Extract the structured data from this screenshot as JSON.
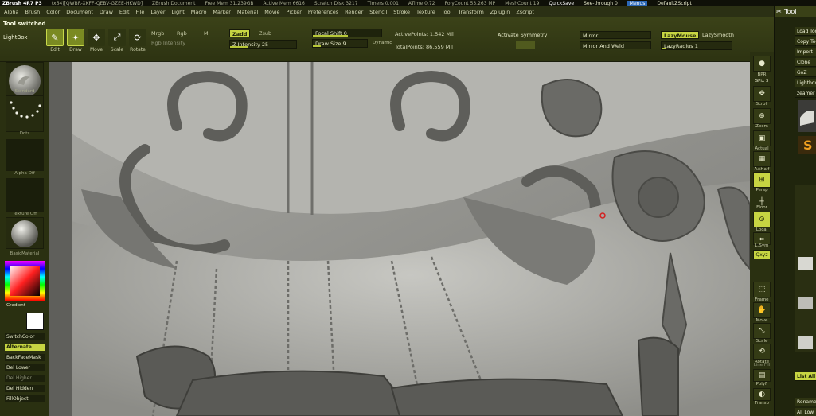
{
  "titlebar": {
    "app": "ZBrush 4R7 P3",
    "build": "(x64)[QWBR-XKFF-QEBV-GZEE-HKWD]",
    "document": "ZBrush Document",
    "free_mem": "Free Mem 31.239GB",
    "active_mem": "Active Mem 6616",
    "scratch": "Scratch Disk 3217",
    "timers": "Timers 0.001",
    "atime": "ATime 0.72",
    "polycount": "PolyCount 53.263 MP",
    "meshcount": "MeshCount 19",
    "quicksave": "QuickSave",
    "see_through": "See-through 0",
    "menus": "Menus",
    "default_script": "DefaultZScript"
  },
  "menubar": [
    "Alpha",
    "Brush",
    "Color",
    "Document",
    "Draw",
    "Edit",
    "File",
    "Layer",
    "Light",
    "Macro",
    "Marker",
    "Material",
    "Movie",
    "Picker",
    "Preferences",
    "Render",
    "Stencil",
    "Stroke",
    "Texture",
    "Tool",
    "Transform",
    "Zplugin",
    "Zscript"
  ],
  "toolbar": {
    "tool_switched": "Tool switched",
    "lightbox": "LightBox",
    "edit": "Edit",
    "draw": "Draw",
    "move": "Move",
    "scale": "Scale",
    "rotate": "Rotate",
    "mrgb": "Mrgb",
    "rgb": "Rgb",
    "m": "M",
    "rgb_intensity": "Rgb Intensity",
    "zadd": "Zadd",
    "zsub": "Zsub",
    "z_intensity": "Z Intensity 25",
    "focal_shift": "Focal Shift 0",
    "draw_size": "Draw Size 9",
    "dynamic": "Dynamic",
    "active_points": "ActivePoints: 1.542 Mil",
    "total_points": "TotalPoints: 86.559 Mil",
    "activate_symmetry": "Activate Symmetry",
    "mirror": "Mirror",
    "mirror_and_weld": "Mirror And Weld",
    "lazymouse": "LazyMouse",
    "lazysmooth": "LazySmooth",
    "lazyradius": "LazyRadius 1"
  },
  "leftshelf": {
    "standard": "Standard",
    "dots": "Dots",
    "alpha_off": "Alpha Off",
    "texture_off": "Texture Off",
    "basicmaterial": "BasicMaterial",
    "gradient": "Gradient",
    "switchcolor": "SwitchColor",
    "alternate": "Alternate",
    "backfacemask": "BackFaceMask",
    "del_lower": "Del Lower",
    "del_higher": "Del Higher",
    "del_hidden": "Del Hidden",
    "fillobject": "FillObject"
  },
  "rightshelf": {
    "bpr": "BPR",
    "spix": "SPix 3",
    "scroll": "Scroll",
    "zoom": "Zoom",
    "actual": "Actual",
    "aahalf": "AAHalf",
    "persp": "Persp",
    "floor": "Floor",
    "local": "Local",
    "lsym": "L.Sym",
    "qxyz": "Qxyz",
    "frame": "Frame",
    "move": "Move",
    "scale": "Scale",
    "rotate": "Rotate",
    "linefill": "Line Fill",
    "polyf": "PolyF",
    "transp": "Transp"
  },
  "toolpanel": {
    "title": "Tool",
    "items": [
      "Load Tool",
      "Copy Tool",
      "Import",
      "Clone",
      "GoZ",
      "Lightbox",
      "zeamer",
      "List All",
      "Rename",
      "All Low"
    ]
  },
  "colors": {
    "accent": "#c7d542",
    "panel": "#2a3011",
    "canvas": "#8f8f8b",
    "main_color": "#ff2020",
    "secondary_color": "#ffffff"
  }
}
